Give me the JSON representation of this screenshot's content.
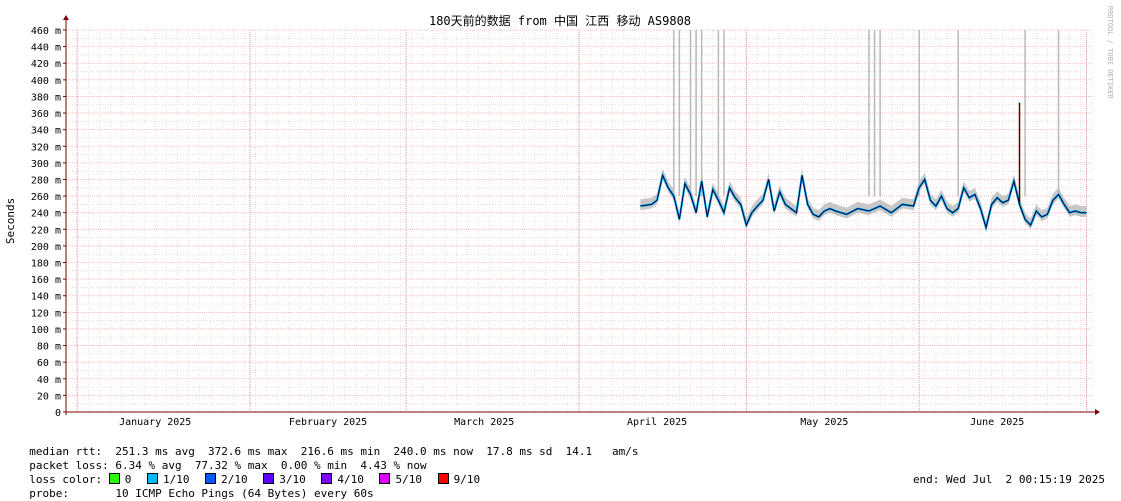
{
  "chart_data": {
    "type": "line",
    "title": "180天前的数据 from 中国 江西 移动 AS9808",
    "ylabel": "Seconds",
    "watermark": "RRDTOOL / TOBI OETIKER",
    "ylim": [
      0,
      460
    ],
    "y_unit": "m",
    "y_ticks": [
      0,
      20,
      40,
      60,
      80,
      100,
      120,
      140,
      160,
      180,
      200,
      220,
      240,
      260,
      280,
      300,
      320,
      340,
      360,
      380,
      400,
      420,
      440,
      460
    ],
    "x_range": [
      "2024-12-30",
      "2025-07-02"
    ],
    "x_ticks": [
      {
        "label": "January 2025",
        "date": "2025-01-15"
      },
      {
        "label": "February 2025",
        "date": "2025-02-15"
      },
      {
        "label": "March 2025",
        "date": "2025-03-15"
      },
      {
        "label": "April 2025",
        "date": "2025-04-15"
      },
      {
        "label": "May 2025",
        "date": "2025-05-15"
      },
      {
        "label": "June 2025",
        "date": "2025-06-15"
      }
    ],
    "grid": true,
    "series": [
      {
        "name": "median rtt",
        "x": [
          "2025-04-12",
          "2025-04-14",
          "2025-04-15",
          "2025-04-16",
          "2025-04-17",
          "2025-04-18",
          "2025-04-19",
          "2025-04-20",
          "2025-04-21",
          "2025-04-22",
          "2025-04-23",
          "2025-04-24",
          "2025-04-25",
          "2025-04-26",
          "2025-04-27",
          "2025-04-28",
          "2025-04-29",
          "2025-04-30",
          "2025-05-01",
          "2025-05-02",
          "2025-05-03",
          "2025-05-04",
          "2025-05-05",
          "2025-05-06",
          "2025-05-07",
          "2025-05-08",
          "2025-05-09",
          "2025-05-10",
          "2025-05-11",
          "2025-05-12",
          "2025-05-13",
          "2025-05-14",
          "2025-05-15",
          "2025-05-16",
          "2025-05-17",
          "2025-05-18",
          "2025-05-19",
          "2025-05-21",
          "2025-05-23",
          "2025-05-25",
          "2025-05-27",
          "2025-05-29",
          "2025-05-31",
          "2025-06-01",
          "2025-06-02",
          "2025-06-03",
          "2025-06-04",
          "2025-06-05",
          "2025-06-06",
          "2025-06-07",
          "2025-06-08",
          "2025-06-09",
          "2025-06-10",
          "2025-06-11",
          "2025-06-12",
          "2025-06-13",
          "2025-06-14",
          "2025-06-15",
          "2025-06-16",
          "2025-06-17",
          "2025-06-18",
          "2025-06-19",
          "2025-06-20",
          "2025-06-21",
          "2025-06-22",
          "2025-06-23",
          "2025-06-24",
          "2025-06-25",
          "2025-06-26",
          "2025-06-27",
          "2025-06-28",
          "2025-06-29",
          "2025-06-30",
          "2025-07-01"
        ],
        "y": [
          248,
          250,
          255,
          285,
          270,
          260,
          232,
          275,
          262,
          240,
          278,
          235,
          268,
          255,
          240,
          270,
          258,
          250,
          225,
          240,
          248,
          255,
          280,
          242,
          265,
          250,
          245,
          240,
          285,
          250,
          238,
          235,
          242,
          245,
          242,
          240,
          238,
          245,
          242,
          248,
          240,
          250,
          248,
          270,
          280,
          255,
          248,
          260,
          245,
          240,
          245,
          270,
          258,
          262,
          245,
          222,
          250,
          258,
          252,
          255,
          278,
          250,
          232,
          225,
          242,
          235,
          238,
          255,
          262,
          250,
          240,
          242,
          240,
          240
        ]
      }
    ],
    "spikes": [
      {
        "x": "2025-06-19",
        "y": 372.6
      }
    ]
  },
  "legend": {
    "median_rtt": "median rtt:  251.3 ms avg  372.6 ms max  216.6 ms min  240.0 ms now  17.8 ms sd  14.1   am/s",
    "packet_loss": "packet loss: 6.34 % avg  77.32 % max  0.00 % min  4.43 % now",
    "loss_color_label": "loss color:",
    "loss_colors": [
      {
        "label": "0",
        "color": "#26ff00"
      },
      {
        "label": "1/10",
        "color": "#00b8ff"
      },
      {
        "label": "2/10",
        "color": "#0059ff"
      },
      {
        "label": "3/10",
        "color": "#5e00ff"
      },
      {
        "label": "4/10",
        "color": "#7e00ff"
      },
      {
        "label": "5/10",
        "color": "#dd00ff"
      },
      {
        "label": "9/10",
        "color": "#ff0000"
      }
    ],
    "probe": "probe:       10 ICMP Echo Pings (64 Bytes) every 60s",
    "end": "end: Wed Jul  2 00:15:19 2025"
  },
  "colors": {
    "grid": "#f2b3b3",
    "axis": "#800000",
    "line": "#000033",
    "smoke": "#b0b0b0"
  }
}
